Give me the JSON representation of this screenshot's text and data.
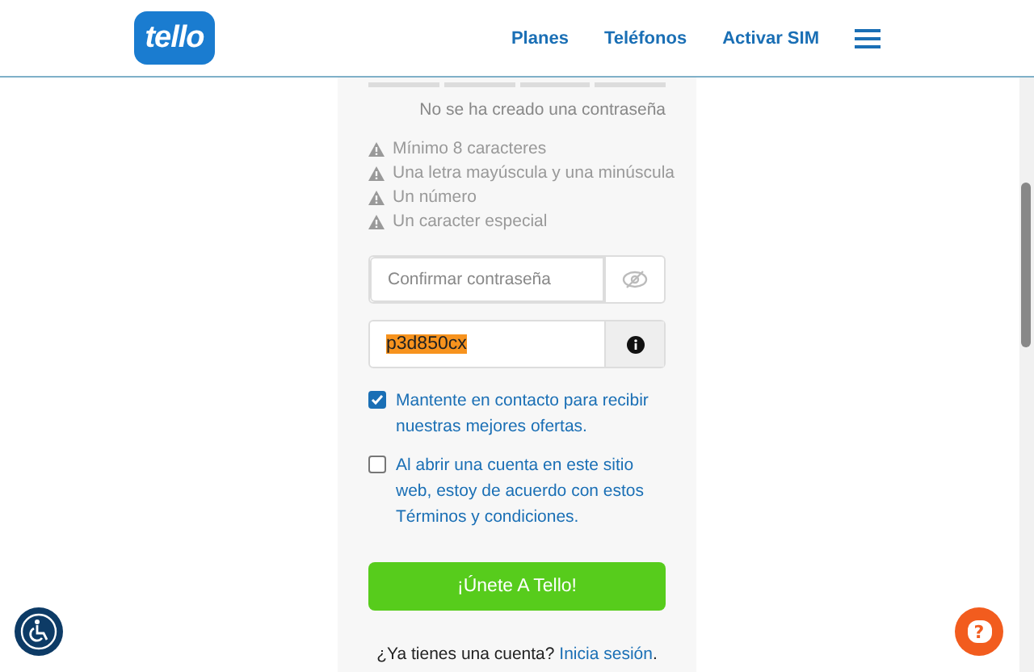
{
  "header": {
    "logo": "tello",
    "nav": [
      "Planes",
      "Teléfonos",
      "Activar SIM"
    ]
  },
  "strength": {
    "segments": [
      {
        "filled": false
      },
      {
        "filled": false
      },
      {
        "filled": false
      },
      {
        "filled": false
      }
    ],
    "message": "No se ha creado una contraseña"
  },
  "requirements": [
    {
      "text": "Mínimo 8 caracteres",
      "met": false
    },
    {
      "text": "Una letra mayúscula y una minúscula",
      "met": false
    },
    {
      "text": "Un número",
      "met": false
    },
    {
      "text": "Un caracter especial",
      "met": false
    }
  ],
  "confirm_field": {
    "placeholder": "Confirmar contraseña"
  },
  "code_field": {
    "value": "p3d850cx",
    "highlighted": true
  },
  "checkboxes": [
    {
      "label": "Mantente en contacto para recibir nuestras mejores ofertas.",
      "checked": true
    },
    {
      "label": "Al abrir una cuenta en este sitio web, estoy de acuerdo con estos Términos y condiciones.",
      "checked": false
    }
  ],
  "submit": "¡Únete A Tello!",
  "signin": {
    "prompt": "¿Ya tienes una cuenta?",
    "link": "Inicia sesión",
    "end": "."
  },
  "help_button": {
    "label": "?"
  }
}
